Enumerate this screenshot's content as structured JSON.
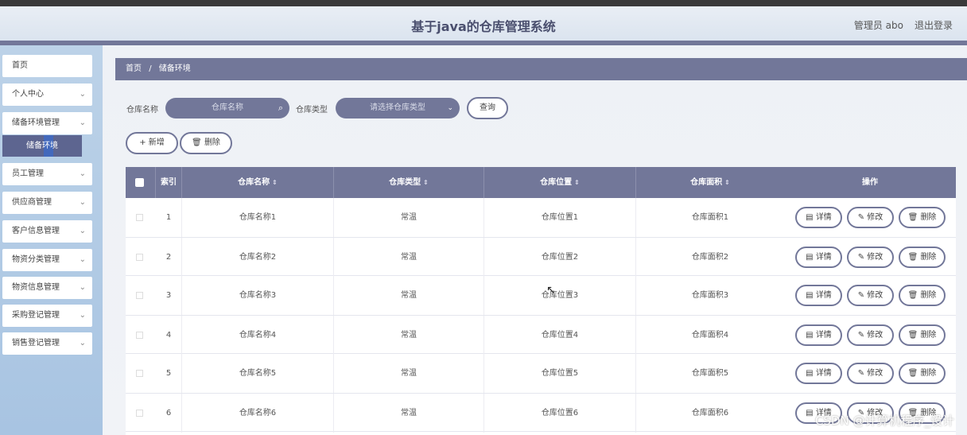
{
  "header": {
    "title": "基于java的仓库管理系统",
    "user": "管理员 abo",
    "logout": "退出登录"
  },
  "sidebar": {
    "items": [
      {
        "label": "首页",
        "has_children": false
      },
      {
        "label": "个人中心",
        "has_children": true
      },
      {
        "label": "储备环境管理",
        "has_children": true
      },
      {
        "label": "员工管理",
        "has_children": true
      },
      {
        "label": "供应商管理",
        "has_children": true
      },
      {
        "label": "客户信息管理",
        "has_children": true
      },
      {
        "label": "物资分类管理",
        "has_children": true
      },
      {
        "label": "物资信息管理",
        "has_children": true
      },
      {
        "label": "采购登记管理",
        "has_children": true
      },
      {
        "label": "销售登记管理",
        "has_children": true
      }
    ],
    "active_sub": "储备环境"
  },
  "breadcrumb": [
    "首页",
    "/",
    "储备环境"
  ],
  "search": {
    "name_label": "仓库名称",
    "name_placeholder": "仓库名称",
    "type_label": "仓库类型",
    "type_placeholder": "请选择仓库类型",
    "query_button": "查询"
  },
  "actions": {
    "add_button": "+ 新增",
    "delete_button": "删除"
  },
  "table": {
    "columns": [
      "索引",
      "仓库名称",
      "仓库类型",
      "仓库位置",
      "仓库面积",
      "操作"
    ],
    "rows": [
      {
        "index": "1",
        "name": "仓库名称1",
        "type": "常温",
        "location": "仓库位置1",
        "area": "仓库面积1"
      },
      {
        "index": "2",
        "name": "仓库名称2",
        "type": "常温",
        "location": "仓库位置2",
        "area": "仓库面积2"
      },
      {
        "index": "3",
        "name": "仓库名称3",
        "type": "常温",
        "location": "仓库位置3",
        "area": "仓库面积3"
      },
      {
        "index": "4",
        "name": "仓库名称4",
        "type": "常温",
        "location": "仓库位置4",
        "area": "仓库面积4"
      },
      {
        "index": "5",
        "name": "仓库名称5",
        "type": "常温",
        "location": "仓库位置5",
        "area": "仓库面积5"
      },
      {
        "index": "6",
        "name": "仓库名称6",
        "type": "常温",
        "location": "仓库位置6",
        "area": "仓库面积6"
      }
    ],
    "row_buttons": {
      "detail": "详情",
      "edit": "修改",
      "delete": "删除"
    }
  },
  "watermark": "CSDN @计算机程序_设计",
  "colors": {
    "accent": "#727799",
    "sidebar": "#a8c4e2"
  }
}
